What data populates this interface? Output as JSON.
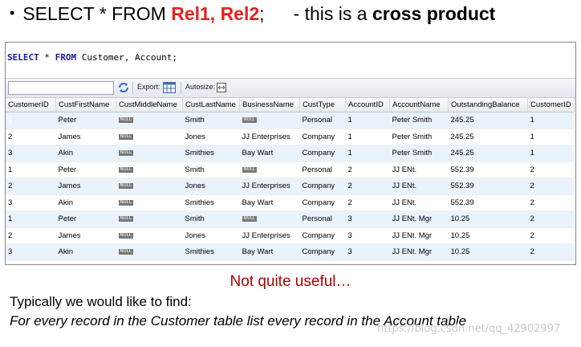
{
  "heading": {
    "bullet": "•",
    "pre": "SELECT * FROM ",
    "rel1": "Rel1, Rel2",
    "semi": ";",
    "mid": "- this is a ",
    "bold": "cross product"
  },
  "query": {
    "select_kw": "SELECT",
    "star": " * ",
    "from_kw": "FROM",
    "rest": " Customer, Account;"
  },
  "toolbar": {
    "export_label": "Export:",
    "autosize_label": "Autosize:"
  },
  "grid": {
    "columns": [
      "CustomerID",
      "CustFirstName",
      "CustMiddleName",
      "CustLastName",
      "BusinessName",
      "CustType",
      "AccountID",
      "AccountName",
      "OutstandingBalance",
      "CustomerID"
    ],
    "null_label": "NULL",
    "rows": [
      [
        "1",
        "Peter",
        "NULL",
        "Smith",
        "NULL",
        "Personal",
        "1",
        "Peter Smith",
        "245.25",
        "1"
      ],
      [
        "2",
        "James",
        "NULL",
        "Jones",
        "JJ Enterprises",
        "Company",
        "1",
        "Peter Smith",
        "245.25",
        "1"
      ],
      [
        "3",
        "Akin",
        "NULL",
        "Smithies",
        "Bay Wart",
        "Company",
        "1",
        "Peter Smith",
        "245.25",
        "1"
      ],
      [
        "1",
        "Peter",
        "NULL",
        "Smith",
        "NULL",
        "Personal",
        "2",
        "JJ ENt.",
        "552.39",
        "2"
      ],
      [
        "2",
        "James",
        "NULL",
        "Jones",
        "JJ Enterprises",
        "Company",
        "2",
        "JJ ENt.",
        "552.39",
        "2"
      ],
      [
        "3",
        "Akin",
        "NULL",
        "Smithies",
        "Bay Wart",
        "Company",
        "2",
        "JJ ENt.",
        "552.39",
        "2"
      ],
      [
        "1",
        "Peter",
        "NULL",
        "Smith",
        "NULL",
        "Personal",
        "3",
        "JJ ENt. Mgr",
        "10.25",
        "2"
      ],
      [
        "2",
        "James",
        "NULL",
        "Jones",
        "JJ Enterprises",
        "Company",
        "3",
        "JJ ENt. Mgr",
        "10.25",
        "2"
      ],
      [
        "3",
        "Akin",
        "NULL",
        "Smithies",
        "Bay Wart",
        "Company",
        "3",
        "JJ ENt. Mgr",
        "10.25",
        "2"
      ]
    ]
  },
  "notes": {
    "not_useful": "Not quite useful…",
    "typically": "Typically we would like to find:",
    "goal": "For every record in the Customer table list every record in the Account table"
  },
  "watermark": "https://blog.csdn.net/qq_42902997",
  "colors": {
    "accent_red": "#e8201b",
    "selection": "#3399ff",
    "note_red": "#b00000"
  }
}
